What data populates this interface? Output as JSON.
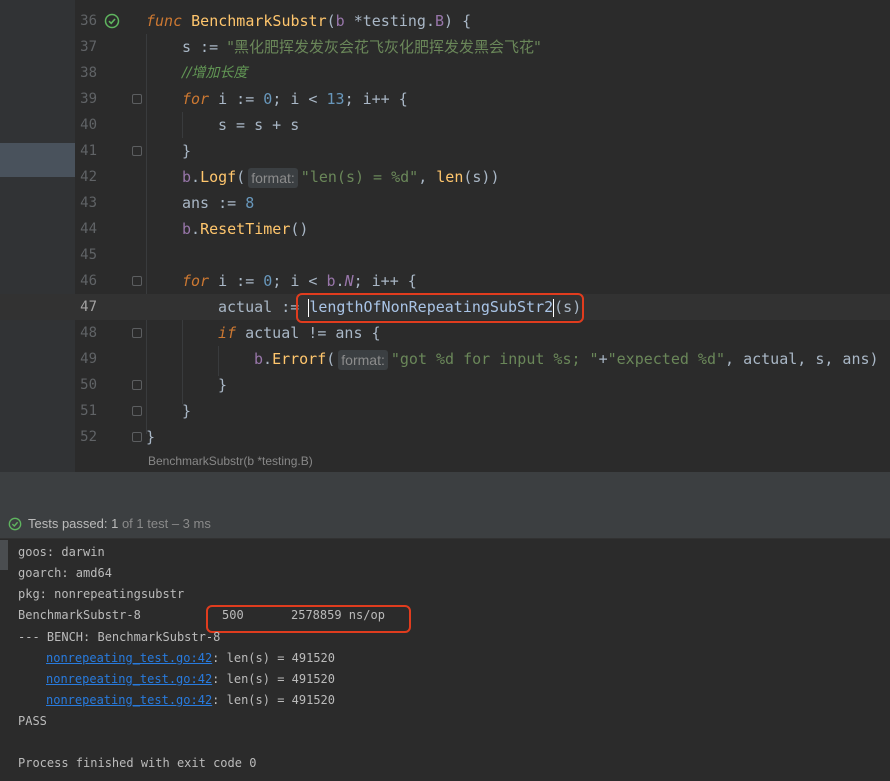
{
  "editor": {
    "lines": [
      {
        "num": "36"
      },
      {
        "num": "37"
      },
      {
        "num": "38"
      },
      {
        "num": "39"
      },
      {
        "num": "40"
      },
      {
        "num": "41"
      },
      {
        "num": "42"
      },
      {
        "num": "43"
      },
      {
        "num": "44"
      },
      {
        "num": "45"
      },
      {
        "num": "46"
      },
      {
        "num": "47"
      },
      {
        "num": "48"
      },
      {
        "num": "49"
      },
      {
        "num": "50"
      },
      {
        "num": "51"
      },
      {
        "num": "52"
      }
    ],
    "code": {
      "l36_func": "func",
      "l36_name": "BenchmarkSubstr",
      "l36_sig_open": "(",
      "l36_param": "b",
      "l36_sig_type": " *testing.",
      "l36_type_B": "B",
      "l36_sig_close": ") {",
      "l37_lhs": "s := ",
      "l37_str": "\"黑化肥挥发发灰会花飞灰化肥挥发发黑会飞花\"",
      "l38_cmt": "//增加长度",
      "l39_for": "for",
      "l39_a": " i := ",
      "l39_zero": "0",
      "l39_b": "; i < ",
      "l39_13": "13",
      "l39_c": "; i++ {",
      "l40": "s = s + s",
      "l41": "}",
      "l42_b": "b",
      "l42_dot": ".",
      "l42_method": "Logf",
      "l42_open": "(",
      "l42_hint": "format:",
      "l42_str": "\"len(s) = %d\"",
      "l42_comma": ", ",
      "l42_len": "len",
      "l42_rest": "(s))",
      "l43_a": "ans := ",
      "l43_num": "8",
      "l44_b": "b",
      "l44_dot": ".",
      "l44_method": "ResetTimer",
      "l44_rest": "()",
      "l46_for": "for",
      "l46_a": " i := ",
      "l46_zero": "0",
      "l46_b": "; i < ",
      "l46_bb": "b",
      "l46_dot": ".",
      "l46_N": "N",
      "l46_c": "; i++ {",
      "l47_a": "actual := ",
      "l47_fn": "lengthOfNonRepeatingSubStr2",
      "l47_rest": "(s)",
      "l48_if": "if",
      "l48_rest": " actual != ans {",
      "l49_b": "b",
      "l49_dot": ".",
      "l49_method": "Errorf",
      "l49_open": "(",
      "l49_hint": "format:",
      "l49_str1": "\"got %d for input %s; \"",
      "l49_plus": "+",
      "l49_str2": "\"expected %d\"",
      "l49_rest": ", actual, s, ans)",
      "l50": "}",
      "l51": "}",
      "l52": "}"
    },
    "breadcrumb": "BenchmarkSubstr(b *testing.B)"
  },
  "test_panel": {
    "status_prefix": "Tests passed: ",
    "status_count": "1",
    "status_suffix": " of 1 test – 3 ms"
  },
  "console": {
    "lines": [
      "goos: darwin",
      "goarch: amd64",
      "pkg: nonrepeatingsubstr"
    ],
    "bench_name": "BenchmarkSubstr-8",
    "bench_iters": "500",
    "bench_result": "2578859 ns/op",
    "bench_header": "--- BENCH: BenchmarkSubstr-8",
    "log_entries": [
      {
        "link": "nonrepeating_test.go:42",
        "text": ": len(s) = 491520"
      },
      {
        "link": "nonrepeating_test.go:42",
        "text": ": len(s) = 491520"
      },
      {
        "link": "nonrepeating_test.go:42",
        "text": ": len(s) = 491520"
      }
    ],
    "pass": "PASS",
    "exit": "Process finished with exit code 0"
  },
  "colors": {
    "annotation_red": "#e03c1e",
    "success_green": "#5fb55f"
  }
}
